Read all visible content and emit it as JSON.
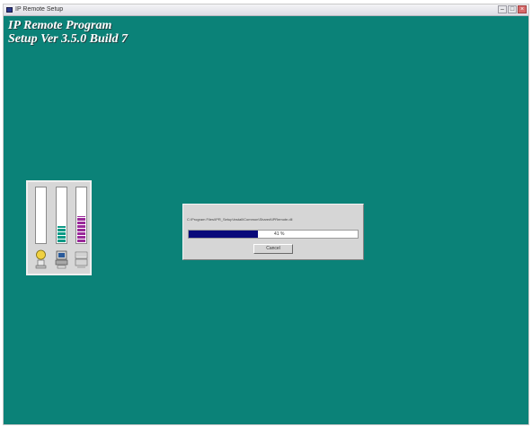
{
  "window": {
    "title": "IP Remote Setup"
  },
  "banner": {
    "line1": "IP Remote Program",
    "line2": "Setup Ver 3.5.0 Build 7"
  },
  "meters": [
    {
      "name": "cpu-meter",
      "level": 0.0,
      "color": "#ffffff",
      "icon": "user-icon"
    },
    {
      "name": "disk-meter",
      "level": 0.32,
      "color": "#0e9a86",
      "icon": "disk-icon"
    },
    {
      "name": "memory-meter",
      "level": 0.5,
      "color": "#9a2a9a",
      "icon": "drive-icon"
    }
  ],
  "dialog": {
    "message": "C:\\Program Files\\IPR_Setup\\Install\\Common\\Shared\\IPRemote.dll",
    "progress_percent": 41,
    "progress_label": "41 %",
    "cancel_label": "Cancel"
  },
  "colors": {
    "desktop": "#0b8278",
    "progress": "#0a0a7a"
  }
}
